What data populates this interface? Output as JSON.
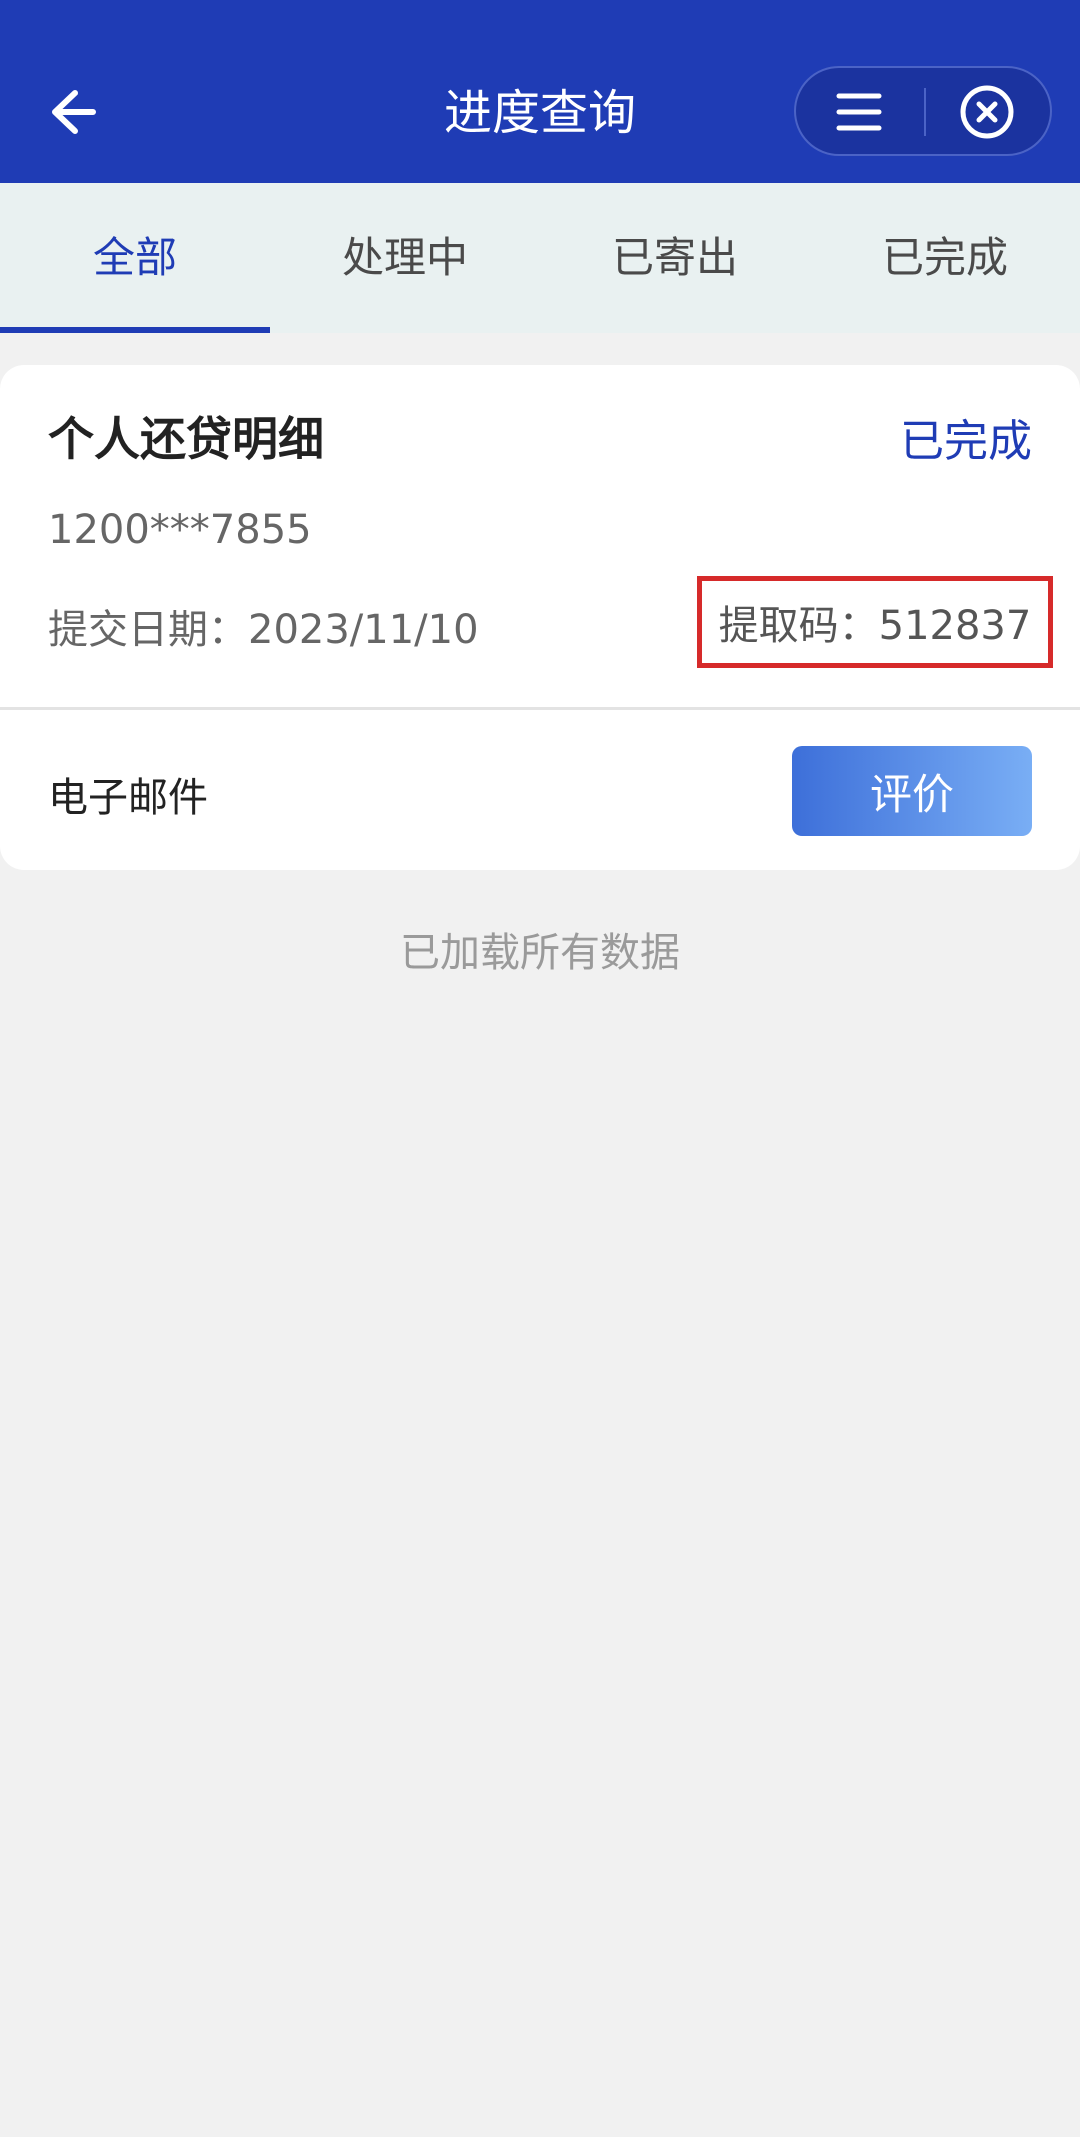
{
  "header": {
    "title": "进度查询",
    "back_icon": "arrow-left-icon",
    "menu_icon": "menu-lines-icon",
    "close_icon": "close-circle-icon"
  },
  "tabs": [
    {
      "label": "全部",
      "active": true
    },
    {
      "label": "处理中",
      "active": false
    },
    {
      "label": "已寄出",
      "active": false
    },
    {
      "label": "已完成",
      "active": false
    }
  ],
  "card": {
    "title": "个人还贷明细",
    "status": "已完成",
    "account": "1200***7855",
    "date_text": "提交日期：2023/11/10",
    "code_text": "提取码：512837",
    "delivery_method": "电子邮件",
    "rate_label": "评价"
  },
  "footer_note": "已加载所有数据",
  "colors": {
    "brand": "#1f3cb5",
    "highlight": "#d62a2a"
  }
}
